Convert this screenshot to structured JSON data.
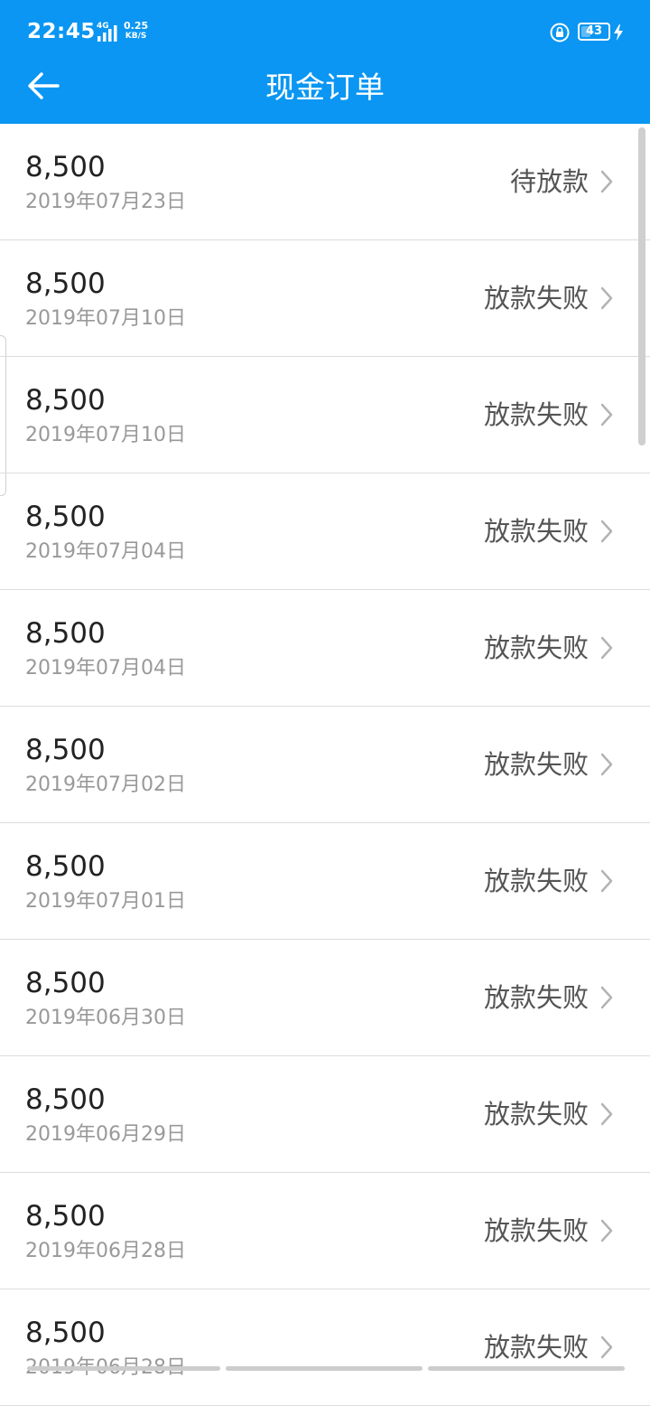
{
  "status_bar": {
    "time": "22:45",
    "network": "4G",
    "speed_value": "0.25",
    "speed_unit": "KB/S",
    "battery": "43",
    "battery_level": 0.43
  },
  "header": {
    "title": "现金订单"
  },
  "colors": {
    "header_bg": "#0a96f2",
    "amount_text": "#222222",
    "date_text": "#999999",
    "status_text": "#555555"
  },
  "icons": {
    "back": "back-arrow-icon",
    "chevron": "chevron-right-icon",
    "lock": "rotation-lock-icon",
    "charging": "charging-bolt-icon"
  },
  "orders": [
    {
      "amount": "8,500",
      "date": "2019年07月23日",
      "status": "待放款"
    },
    {
      "amount": "8,500",
      "date": "2019年07月10日",
      "status": "放款失败"
    },
    {
      "amount": "8,500",
      "date": "2019年07月10日",
      "status": "放款失败"
    },
    {
      "amount": "8,500",
      "date": "2019年07月04日",
      "status": "放款失败"
    },
    {
      "amount": "8,500",
      "date": "2019年07月04日",
      "status": "放款失败"
    },
    {
      "amount": "8,500",
      "date": "2019年07月02日",
      "status": "放款失败"
    },
    {
      "amount": "8,500",
      "date": "2019年07月01日",
      "status": "放款失败"
    },
    {
      "amount": "8,500",
      "date": "2019年06月30日",
      "status": "放款失败"
    },
    {
      "amount": "8,500",
      "date": "2019年06月29日",
      "status": "放款失败"
    },
    {
      "amount": "8,500",
      "date": "2019年06月28日",
      "status": "放款失败"
    },
    {
      "amount": "8,500",
      "date": "2019年06月28日",
      "status": "放款失败"
    }
  ]
}
